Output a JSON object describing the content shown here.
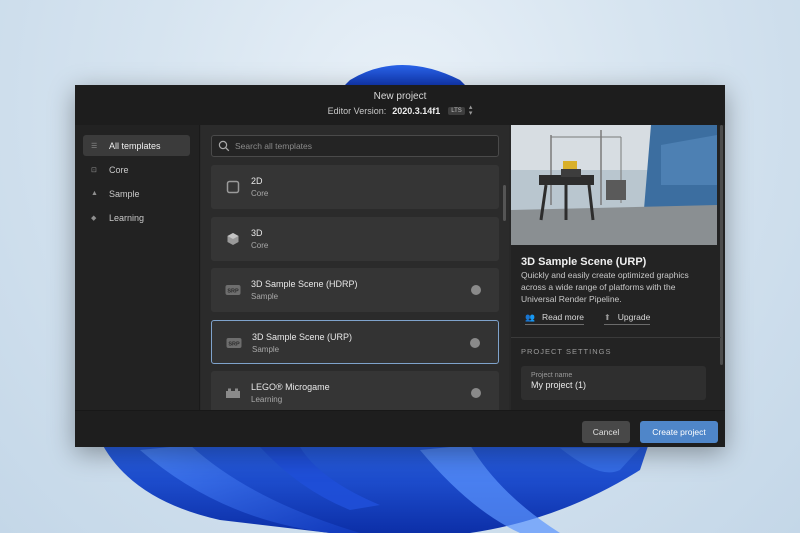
{
  "window": {
    "title": "New project",
    "editor_version_label": "Editor Version:",
    "editor_version": "2020.3.14f1",
    "lts_badge": "LTS"
  },
  "sidebar": {
    "items": [
      {
        "label": "All templates",
        "icon": "list-icon",
        "active": true
      },
      {
        "label": "Core",
        "icon": "box-icon",
        "active": false
      },
      {
        "label": "Sample",
        "icon": "shapes-icon",
        "active": false
      },
      {
        "label": "Learning",
        "icon": "graduation-cap-icon",
        "active": false
      }
    ]
  },
  "search": {
    "placeholder": "Search all templates",
    "value": ""
  },
  "templates": [
    {
      "title": "2D",
      "category": "Core",
      "icon": "square-icon",
      "download": false,
      "selected": false
    },
    {
      "title": "3D",
      "category": "Core",
      "icon": "cube-icon",
      "download": false,
      "selected": false
    },
    {
      "title": "3D Sample Scene (HDRP)",
      "category": "Sample",
      "icon": "srp-icon",
      "download": true,
      "selected": false
    },
    {
      "title": "3D Sample Scene (URP)",
      "category": "Sample",
      "icon": "srp-icon",
      "download": true,
      "selected": true
    },
    {
      "title": "LEGO® Microgame",
      "category": "Learning",
      "icon": "lego-brick-icon",
      "download": true,
      "selected": false
    }
  ],
  "details": {
    "title": "3D Sample Scene (URP)",
    "description": "Quickly and easily create optimized graphics across a wide range of platforms with the Universal Render Pipeline.",
    "read_more": "Read more",
    "upgrade": "Upgrade",
    "section_label": "PROJECT SETTINGS",
    "project_name_label": "Project name",
    "project_name_value": "My project (1)"
  },
  "footer": {
    "cancel": "Cancel",
    "create": "Create project"
  },
  "colors": {
    "accent": "#4f86c9",
    "dialog_bg": "#282828",
    "selected_border": "#7fa3cc"
  }
}
